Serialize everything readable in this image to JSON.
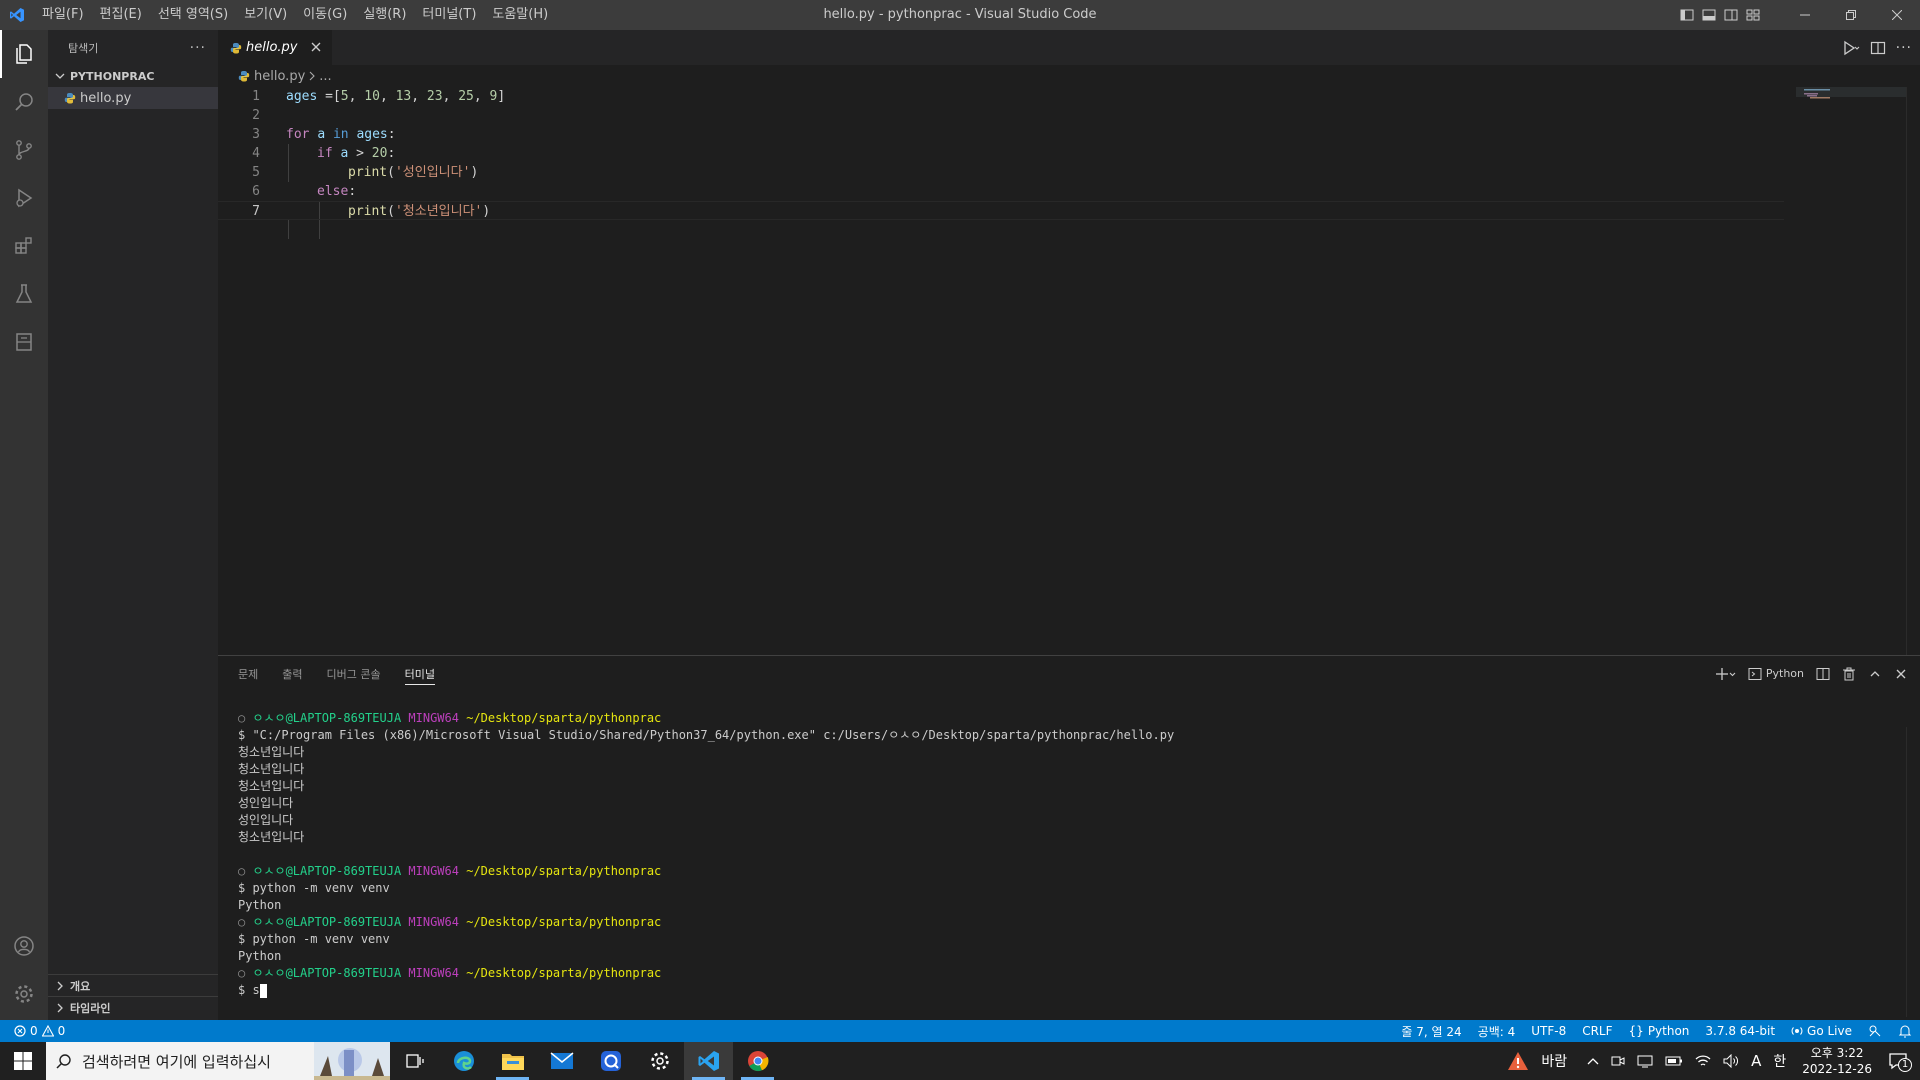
{
  "titlebar": {
    "menus": [
      "파일(F)",
      "편집(E)",
      "선택 영역(S)",
      "보기(V)",
      "이동(G)",
      "실행(R)",
      "터미널(T)",
      "도움말(H)"
    ],
    "title": "hello.py - pythonprac - Visual Studio Code"
  },
  "sidebar": {
    "header": "탐색기",
    "folder": "PYTHONPRAC",
    "file": "hello.py",
    "outline": "개요",
    "timeline": "타임라인"
  },
  "editor": {
    "tab_label": "hello.py",
    "breadcrumb_file": "hello.py",
    "breadcrumb_rest": "...",
    "line_numbers": [
      "1",
      "2",
      "3",
      "4",
      "5",
      "6",
      "7"
    ],
    "line1": {
      "a": "ages",
      "b": " =[",
      "c": "5",
      "d": ", ",
      "e": "10",
      "f": ", ",
      "g": "13",
      "h": ", ",
      "i": "23",
      "j": ", ",
      "k": "25",
      "l": ", ",
      "m": "9",
      "n": "]"
    },
    "line3": {
      "a": "for",
      "b": " ",
      "c": "a",
      "d": " ",
      "e": "in",
      "f": " ",
      "g": "ages",
      "h": ":"
    },
    "line4": {
      "a": "if",
      "b": " ",
      "c": "a",
      "d": " > ",
      "e": "20",
      "f": ":"
    },
    "line5": {
      "a": "print",
      "b": "(",
      "c": "'성인입니다'",
      "d": ")"
    },
    "line6": {
      "a": "else",
      "b": ":"
    },
    "line7": {
      "a": "print",
      "b": "(",
      "c": "'청소년입니다'",
      "d": ")"
    }
  },
  "panel": {
    "tabs": [
      "문제",
      "출력",
      "디버그 콘솔",
      "터미널"
    ],
    "terminal_profile": "Python"
  },
  "terminal": {
    "prompt_user": "ㅇㅅㅇ@LAPTOP-869TEUJA",
    "prompt_env": "MINGW64",
    "prompt_path": "~/Desktop/sparta/pythonprac",
    "command1": "$ \"C:/Program Files (x86)/Microsoft Visual Studio/Shared/Python37_64/python.exe\" c:/Users/ㅇㅅㅇ/Desktop/sparta/pythonprac/hello.py",
    "outputs": [
      "청소년입니다",
      "청소년입니다",
      "청소년입니다",
      "성인입니다",
      "성인입니다",
      "청소년입니다"
    ],
    "command2": "$ python -m venv venv",
    "out2": "Python",
    "command3": "$ python -m venv venv",
    "out3": "Python",
    "current_input": "$ s"
  },
  "statusbar": {
    "errors": "0",
    "warnings": "0",
    "position": "줄 7, 열 24",
    "spaces": "공백: 4",
    "encoding": "UTF-8",
    "eol": "CRLF",
    "language": "Python",
    "interpreter": "3.7.8 64-bit",
    "golive": "Go Live"
  },
  "taskbar": {
    "search_placeholder": "검색하려면 여기에 입력하십시",
    "weather": "바람",
    "ime": "한",
    "ime2": "A",
    "time": "오후 3:22",
    "date": "2022-12-26",
    "notif_count": "1"
  },
  "colors": {
    "accent": "#007acc",
    "titlebar": "#3c3c3c",
    "activitybar": "#333333",
    "sidebar": "#252526",
    "editor": "#1e1e1e"
  }
}
